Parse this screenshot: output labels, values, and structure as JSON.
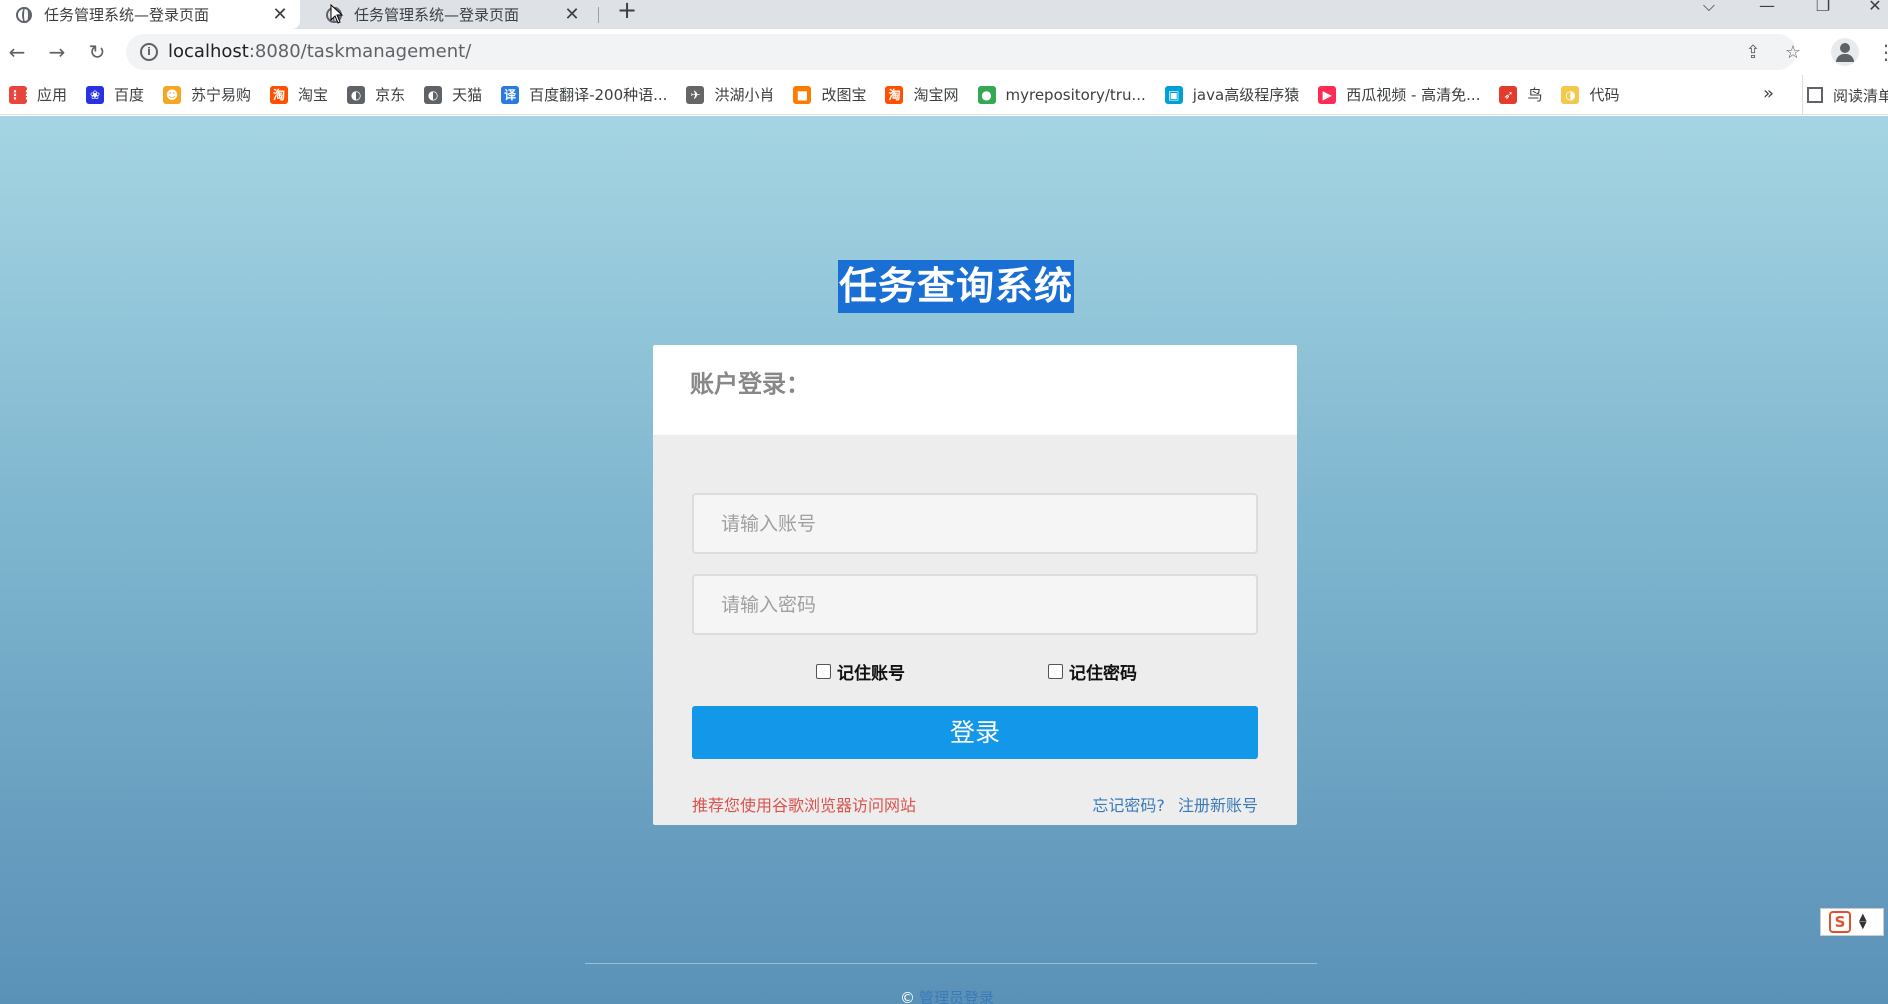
{
  "tabs": [
    {
      "title": "任务管理系统—登录页面",
      "active": true
    },
    {
      "title": "任务管理系统—登录页面",
      "active": false
    }
  ],
  "window_controls": {
    "dropdown": "⌵",
    "minimize": "—",
    "maximize": "❐",
    "close": "✕"
  },
  "toolbar": {
    "url_host": "localhost",
    "url_rest": ":8080/taskmanagement/"
  },
  "bookmarks": [
    {
      "label": "应用",
      "icon": "apps-grid-icon",
      "color": "#e8453c"
    },
    {
      "label": "百度",
      "icon": "baidu-paw-icon",
      "color": "#2932e1"
    },
    {
      "label": "苏宁易购",
      "icon": "suning-icon",
      "color": "#f5a623"
    },
    {
      "label": "淘宝",
      "icon": "taobao-icon",
      "color": "#ff5000"
    },
    {
      "label": "京东",
      "icon": "globe-icon",
      "color": "#5f6368"
    },
    {
      "label": "天猫",
      "icon": "globe-icon",
      "color": "#5f6368"
    },
    {
      "label": "百度翻译-200种语...",
      "icon": "translate-icon",
      "color": "#2b7ae0"
    },
    {
      "label": "洪湖小肖",
      "icon": "bird-icon",
      "color": "#666666"
    },
    {
      "label": "改图宝",
      "icon": "gaitubao-icon",
      "color": "#ff7a00"
    },
    {
      "label": "淘宝网",
      "icon": "taobao-icon",
      "color": "#ff5000"
    },
    {
      "label": "myrepository/tru...",
      "icon": "chrome-icon",
      "color": "#34a853"
    },
    {
      "label": "java高级程序猿",
      "icon": "bilibili-icon",
      "color": "#00a1d6"
    },
    {
      "label": "西瓜视频 - 高清免...",
      "icon": "xigua-icon",
      "color": "#fe2c55"
    },
    {
      "label": "鸟",
      "icon": "bird-red-icon",
      "color": "#e33b2e"
    },
    {
      "label": "代码",
      "icon": "moon-icon",
      "color": "#f2c94c"
    }
  ],
  "bookmarks_more": "»",
  "reading_list": "阅读清单",
  "page": {
    "system_title": "任务查询系统",
    "card_header": "账户登录：",
    "account_placeholder": "请输入账号",
    "password_placeholder": "请输入密码",
    "remember_account": "记住账号",
    "remember_password": "记住密码",
    "login_button": "登录",
    "recommend_text": "推荐您使用谷歌浏览器访问网站",
    "forgot_password": "忘记密码?",
    "register": "注册新账号",
    "copyright_symbol": "©",
    "copyright_link": "管理员登录"
  },
  "colors": {
    "login_button": "#1397e9",
    "recommend_text": "#d9534f",
    "link": "#3a7ab8",
    "title_highlight": "#1a6fd4"
  }
}
